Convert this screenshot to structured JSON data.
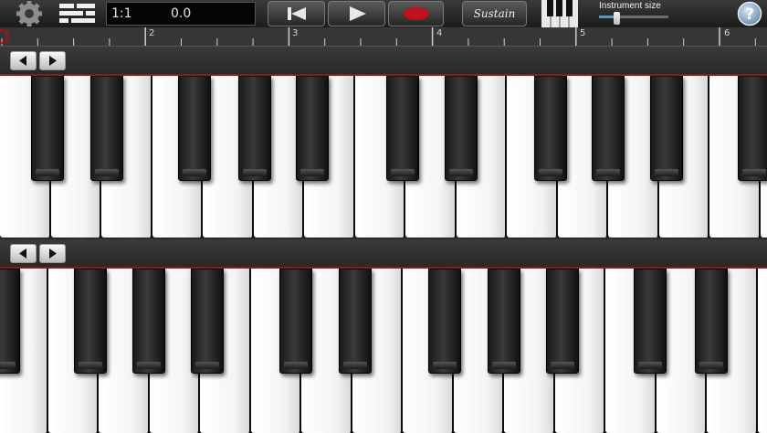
{
  "toolbar": {
    "position": "1:1",
    "time": "0.0",
    "sustain_label": "Sustain",
    "instrument_size_label": "Instrument size",
    "instrument_size_value": 0.25
  },
  "ruler": {
    "measures": [
      "2",
      "3",
      "4",
      "5",
      "6"
    ]
  },
  "colors": {
    "accent": "#36a4dc",
    "record": "#c0111b",
    "keyboard_divider": "#8e1a1a"
  },
  "icons": {
    "settings": "gear-icon",
    "tracks": "tracks-icon",
    "rewind": "skip-back-icon",
    "play": "play-icon",
    "record": "record-icon",
    "keyboard_layout": "piano-keys-icon",
    "help": "help-icon",
    "scroll_left": "arrow-left-icon",
    "scroll_right": "arrow-right-icon"
  }
}
